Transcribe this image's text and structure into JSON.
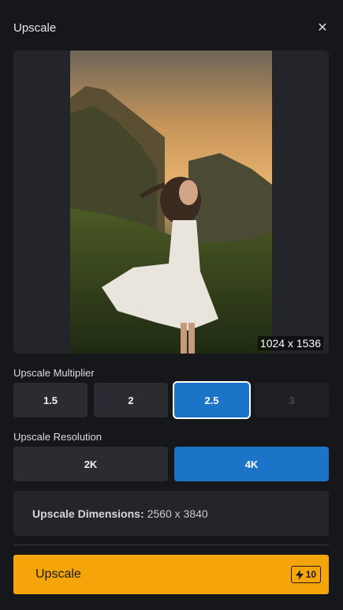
{
  "header": {
    "title": "Upscale",
    "close_glyph": "✕"
  },
  "preview": {
    "dimensions": "1024 x 1536"
  },
  "multiplier": {
    "label": "Upscale Multiplier",
    "options": [
      "1.5",
      "2",
      "2.5",
      "3"
    ],
    "selected": "2.5",
    "disabled": [
      "3"
    ]
  },
  "resolution": {
    "label": "Upscale Resolution",
    "options": [
      "2K",
      "4K"
    ],
    "selected": "4K"
  },
  "dimensions": {
    "key": "Upscale Dimensions:",
    "value": "2560 x 3840"
  },
  "action": {
    "label": "Upscale",
    "credits": "10",
    "credit_icon": "lightning-bolt-icon"
  },
  "colors": {
    "background": "#16171b",
    "panel": "#23252b",
    "accent_blue": "#1c74c9",
    "accent_orange": "#f5a50a"
  }
}
